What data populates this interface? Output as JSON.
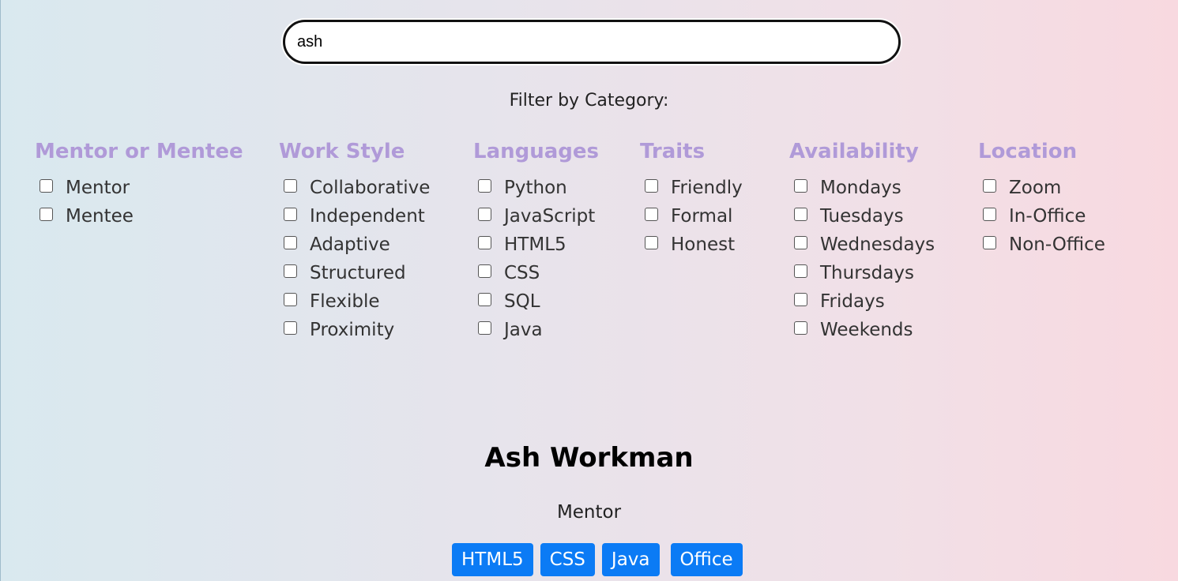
{
  "search": {
    "value": "ash"
  },
  "filter": {
    "label": "Filter by Category:",
    "categories": [
      {
        "title": "Mentor or Mentee",
        "options": [
          "Mentor",
          "Mentee"
        ]
      },
      {
        "title": "Work Style",
        "options": [
          "Collaborative",
          "Independent",
          "Adaptive",
          "Structured",
          "Flexible",
          "Proximity"
        ]
      },
      {
        "title": "Languages",
        "options": [
          "Python",
          "JavaScript",
          "HTML5",
          "CSS",
          "SQL",
          "Java"
        ]
      },
      {
        "title": "Traits",
        "options": [
          "Friendly",
          "Formal",
          "Honest"
        ]
      },
      {
        "title": "Availability",
        "options": [
          "Mondays",
          "Tuesdays",
          "Wednesdays",
          "Thursdays",
          "Fridays",
          "Weekends"
        ]
      },
      {
        "title": "Location",
        "options": [
          "Zoom",
          "In-Office",
          "Non-Office"
        ]
      }
    ]
  },
  "profile": {
    "name": "Ash Workman",
    "role": "Mentor",
    "tags": [
      "HTML5",
      "CSS",
      "Java",
      "Office"
    ]
  },
  "colors": {
    "category_title": "#b09ad8",
    "tag_background": "#0b7bf5"
  }
}
